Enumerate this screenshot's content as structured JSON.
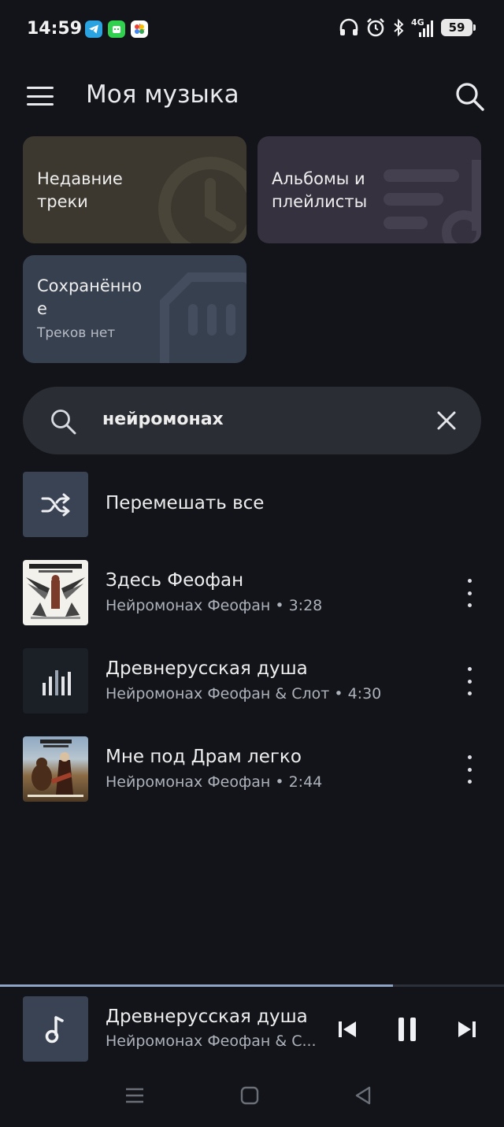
{
  "status_bar": {
    "time": "14:59",
    "network": "4G",
    "battery": "59",
    "icons": [
      "telegram-icon",
      "app-store-icon",
      "photos-icon",
      "headphones-icon",
      "alarm-icon",
      "bluetooth-icon",
      "signal-icon",
      "battery-icon"
    ]
  },
  "header": {
    "title": "Моя музыка"
  },
  "tiles": {
    "recent": {
      "label": "Недавние треки",
      "color": "#3c382f"
    },
    "albums": {
      "label": "Альбомы и плейлисты",
      "color": "#35313f"
    },
    "saved": {
      "label": "Сохранённо е",
      "sub": "Треков нет",
      "color": "#37404f"
    }
  },
  "search": {
    "query": "нейромонах"
  },
  "shuffle": {
    "label": "Перемешать все"
  },
  "tracks": [
    {
      "title": "Здесь Феофан",
      "subtitle": "Нейромонах Феофан • 3:28"
    },
    {
      "title": "Древнерусская душа",
      "subtitle": "Нейромонах Феофан & Слот • 4:30",
      "playing": true
    },
    {
      "title": "Мне под Драм легко",
      "subtitle": "Нейромонах Феофан • 2:44"
    }
  ],
  "player": {
    "title": "Древнерусская душа",
    "subtitle": "Нейромонах Феофан & С...",
    "progress": 0.78
  },
  "colors": {
    "background": "#121419",
    "accent": "#8ea4c4"
  }
}
